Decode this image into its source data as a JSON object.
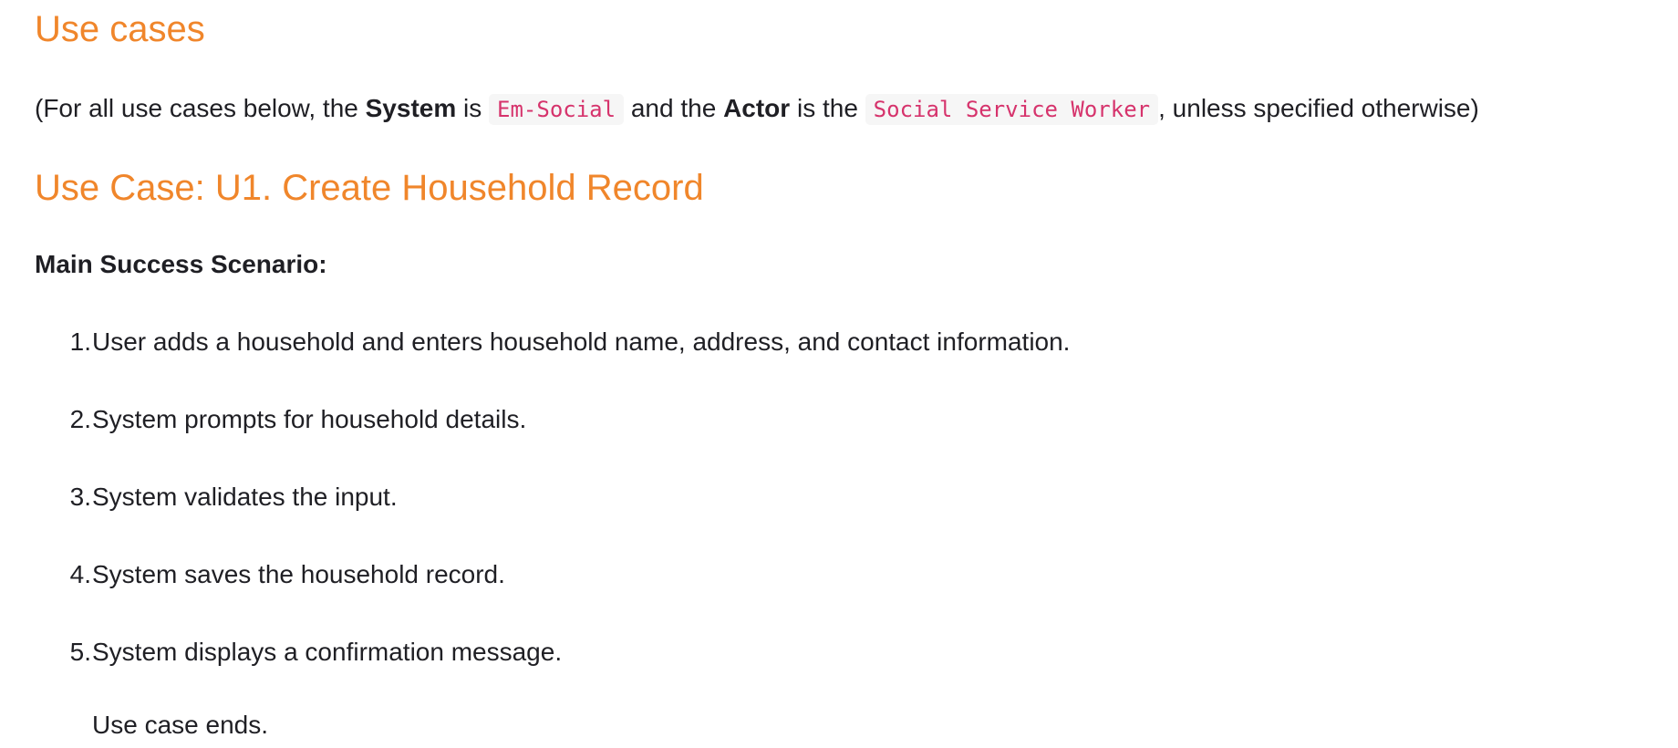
{
  "headings": {
    "use_cases": "Use cases",
    "use_case_u1": "Use Case: U1. Create Household Record"
  },
  "intro": {
    "open": "(For all use cases below, the ",
    "system_label": "System",
    "is": " is ",
    "system_value": "Em-Social",
    "and_the": " and the ",
    "actor_label": "Actor",
    "is_the": " is the ",
    "actor_value": "Social Service Worker",
    "close": ", unless specified otherwise)"
  },
  "scenario": {
    "label": "Main Success Scenario:",
    "steps": [
      {
        "num": "1.",
        "text": "User adds a household and enters household name, address, and contact information."
      },
      {
        "num": "2.",
        "text": "System prompts for household details."
      },
      {
        "num": "3.",
        "text": "System validates the input."
      },
      {
        "num": "4.",
        "text": "System saves the household record."
      },
      {
        "num": "5.",
        "text": "System displays a confirmation message."
      }
    ],
    "end_note": "Use case ends."
  },
  "colors": {
    "heading": "#f0862b",
    "code_text": "#d6336c",
    "code_bg": "#f6f6f6",
    "body_text": "#1f1f24"
  }
}
